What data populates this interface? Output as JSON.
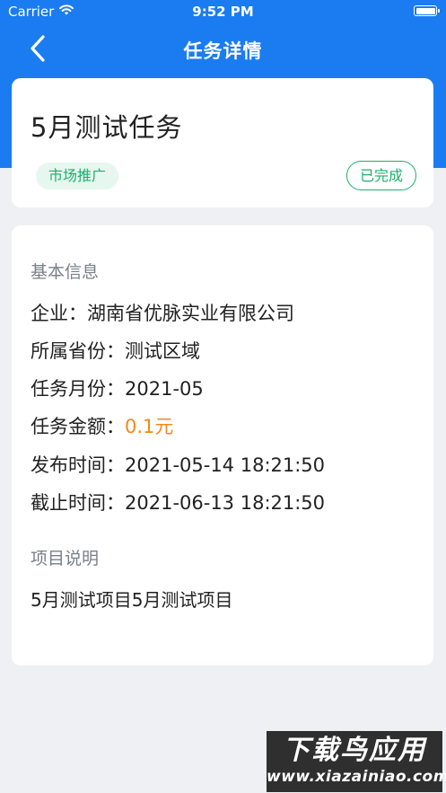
{
  "status_bar": {
    "carrier": "Carrier",
    "time": "9:52 PM",
    "wifi_icon": "wifi-icon",
    "battery_icon": "battery-icon"
  },
  "nav": {
    "title": "任务详情",
    "back_icon": "chevron-left-icon"
  },
  "task": {
    "title": "5月测试任务",
    "category": "市场推广",
    "status": "已完成"
  },
  "basic_info": {
    "label": "基本信息",
    "rows": [
      {
        "label": "企业：",
        "value": "湖南省优脉实业有限公司"
      },
      {
        "label": "所属省份：",
        "value": "测试区域"
      },
      {
        "label": "任务月份：",
        "value": "2021-05"
      },
      {
        "label": "任务金额：",
        "value": "0.1元"
      },
      {
        "label": "发布时间：",
        "value": "2021-05-14 18:21:50"
      },
      {
        "label": "截止时间：",
        "value": "2021-06-13 18:21:50"
      }
    ]
  },
  "project": {
    "label": "项目说明",
    "description": "5月测试项目5月测试项目"
  },
  "watermark": {
    "main": "下载鸟应用",
    "url": "www.xiazainiao.com"
  },
  "colors": {
    "primary": "#1a7cf0",
    "success": "#1fae6e",
    "amount": "#f08a1c"
  }
}
